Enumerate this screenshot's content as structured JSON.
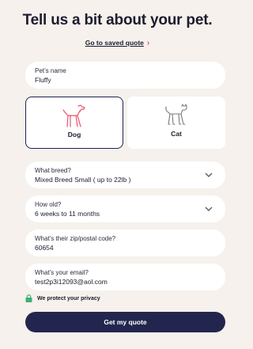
{
  "header": {
    "title": "Tell us a bit about your pet.",
    "saved_quote_link": "Go to saved quote",
    "chevron_glyph": "›"
  },
  "pet_name": {
    "label": "Pet’s name",
    "value": "Fluffy"
  },
  "pet_type": {
    "options": [
      {
        "label": "Dog",
        "selected": true,
        "icon": "dog-icon"
      },
      {
        "label": "Cat",
        "selected": false,
        "icon": "cat-icon"
      }
    ]
  },
  "breed": {
    "label": "What breed?",
    "value": "Mixed Breed Small ( up to 22lb )"
  },
  "age": {
    "label": "How old?",
    "value": "6 weeks to 11 months"
  },
  "zip": {
    "label": "What’s their zip/postal code?",
    "value": "60654"
  },
  "email": {
    "label": "What’s your email?",
    "value": "test2p3i12093@aol.com"
  },
  "privacy": {
    "text": "We protect your privacy",
    "icon": "lock-icon"
  },
  "cta": {
    "label": "Get my quote"
  },
  "colors": {
    "accent": "#e8556a",
    "primary": "#22264f",
    "background": "#f6f1ec",
    "lock": "#3fae7a"
  }
}
